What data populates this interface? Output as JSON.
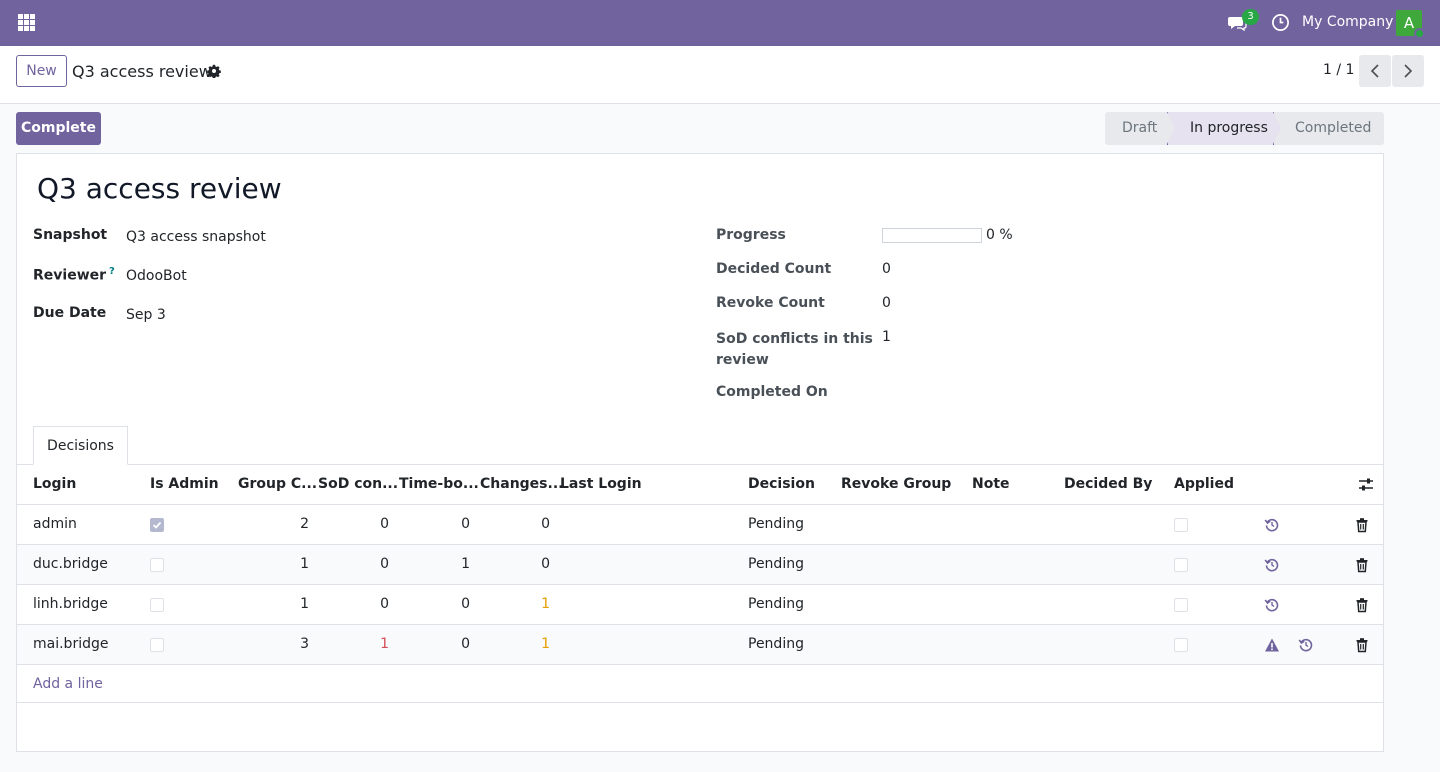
{
  "navbar": {
    "messages_badge": "3",
    "company": "My Company",
    "avatar_initial": "A",
    "icons": [
      "apps-icon",
      "chat-icon",
      "clock-icon"
    ]
  },
  "control_panel": {
    "new_label": "New",
    "breadcrumb": "Q3 access review",
    "pager": "1 / 1"
  },
  "actions": {
    "complete_label": "Complete"
  },
  "statusbar": {
    "stages": [
      "Draft",
      "In progress",
      "Completed"
    ],
    "active": "In progress"
  },
  "form": {
    "title": "Q3 access review",
    "snapshot_label": "Snapshot",
    "snapshot_value": "Q3 access snapshot",
    "reviewer_label": "Reviewer",
    "reviewer_help": "?",
    "reviewer_value": "OdooBot",
    "due_label": "Due Date",
    "due_value": "Sep 3",
    "progress_label": "Progress",
    "progress_value": 0,
    "progress_text": "0 %",
    "decided_label": "Decided Count",
    "decided_value": "0",
    "revoke_label": "Revoke Count",
    "revoke_value": "0",
    "sod_label_1": "SoD conflicts in this",
    "sod_label_2": "review",
    "sod_value": "1",
    "completed_label": "Completed On"
  },
  "tabs": {
    "decisions": "Decisions"
  },
  "table": {
    "headers": [
      "Login",
      "Is Admin",
      "Group C...",
      "SoD con...",
      "Time-bo...",
      "Changes...",
      "Last Login",
      "Decision",
      "Revoke Group",
      "Note",
      "Decided By",
      "Applied"
    ],
    "rows": [
      {
        "login": "admin",
        "is_admin": true,
        "group_count": "2",
        "sod": "0",
        "timebound": "0",
        "changes": "0",
        "decision": "Pending",
        "warning": false
      },
      {
        "login": "duc.bridge",
        "is_admin": false,
        "group_count": "1",
        "sod": "0",
        "timebound": "1",
        "changes": "0",
        "decision": "Pending",
        "warning": false
      },
      {
        "login": "linh.bridge",
        "is_admin": false,
        "group_count": "1",
        "sod": "0",
        "timebound": "0",
        "changes": "1",
        "decision": "Pending",
        "warning": false
      },
      {
        "login": "mai.bridge",
        "is_admin": false,
        "group_count": "3",
        "sod": "1",
        "timebound": "0",
        "changes": "1",
        "decision": "Pending",
        "warning": true
      }
    ],
    "add_line": "Add a line"
  },
  "colors": {
    "brand": "#71639e",
    "success": "#28a745",
    "danger": "#d44c59",
    "warning": "#e99d00"
  }
}
